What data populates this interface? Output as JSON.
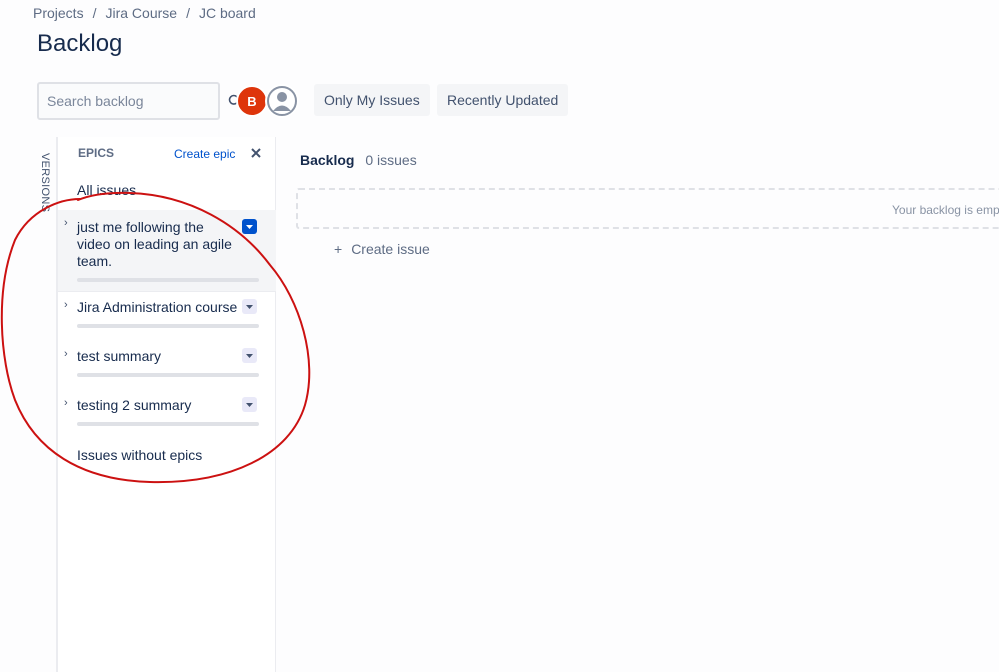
{
  "breadcrumbs": [
    {
      "label": "Projects"
    },
    {
      "label": "Jira Course"
    },
    {
      "label": "JC board"
    }
  ],
  "page_title": "Backlog",
  "search": {
    "placeholder": "Search backlog",
    "icon": "search-icon"
  },
  "avatars": [
    {
      "initial": "B",
      "color": "#de350b"
    },
    {
      "icon": "user-avatar-icon",
      "color": "#8993a4"
    }
  ],
  "quick_filters": {
    "only_my_issues": "Only My Issues",
    "recently_updated": "Recently Updated"
  },
  "versions_tab": "VERSIONS",
  "epics_panel": {
    "title": "EPICS",
    "create_epic": "Create epic",
    "close_icon": "close-icon",
    "all_issues": "All issues",
    "epics": [
      {
        "name": "just me following the video on leading an agile team.",
        "selected": true
      },
      {
        "name": "Jira Administration course",
        "selected": false
      },
      {
        "name": "test summary",
        "selected": false
      },
      {
        "name": "testing 2 summary",
        "selected": false
      }
    ],
    "issues_without_epics": "Issues without epics"
  },
  "backlog": {
    "title": "Backlog",
    "count": "0 issues",
    "empty_message": "Your backlog is empt",
    "create_issue": "Create issue"
  },
  "colors": {
    "accent": "#0052cc",
    "annotation_red": "#cc1111"
  }
}
